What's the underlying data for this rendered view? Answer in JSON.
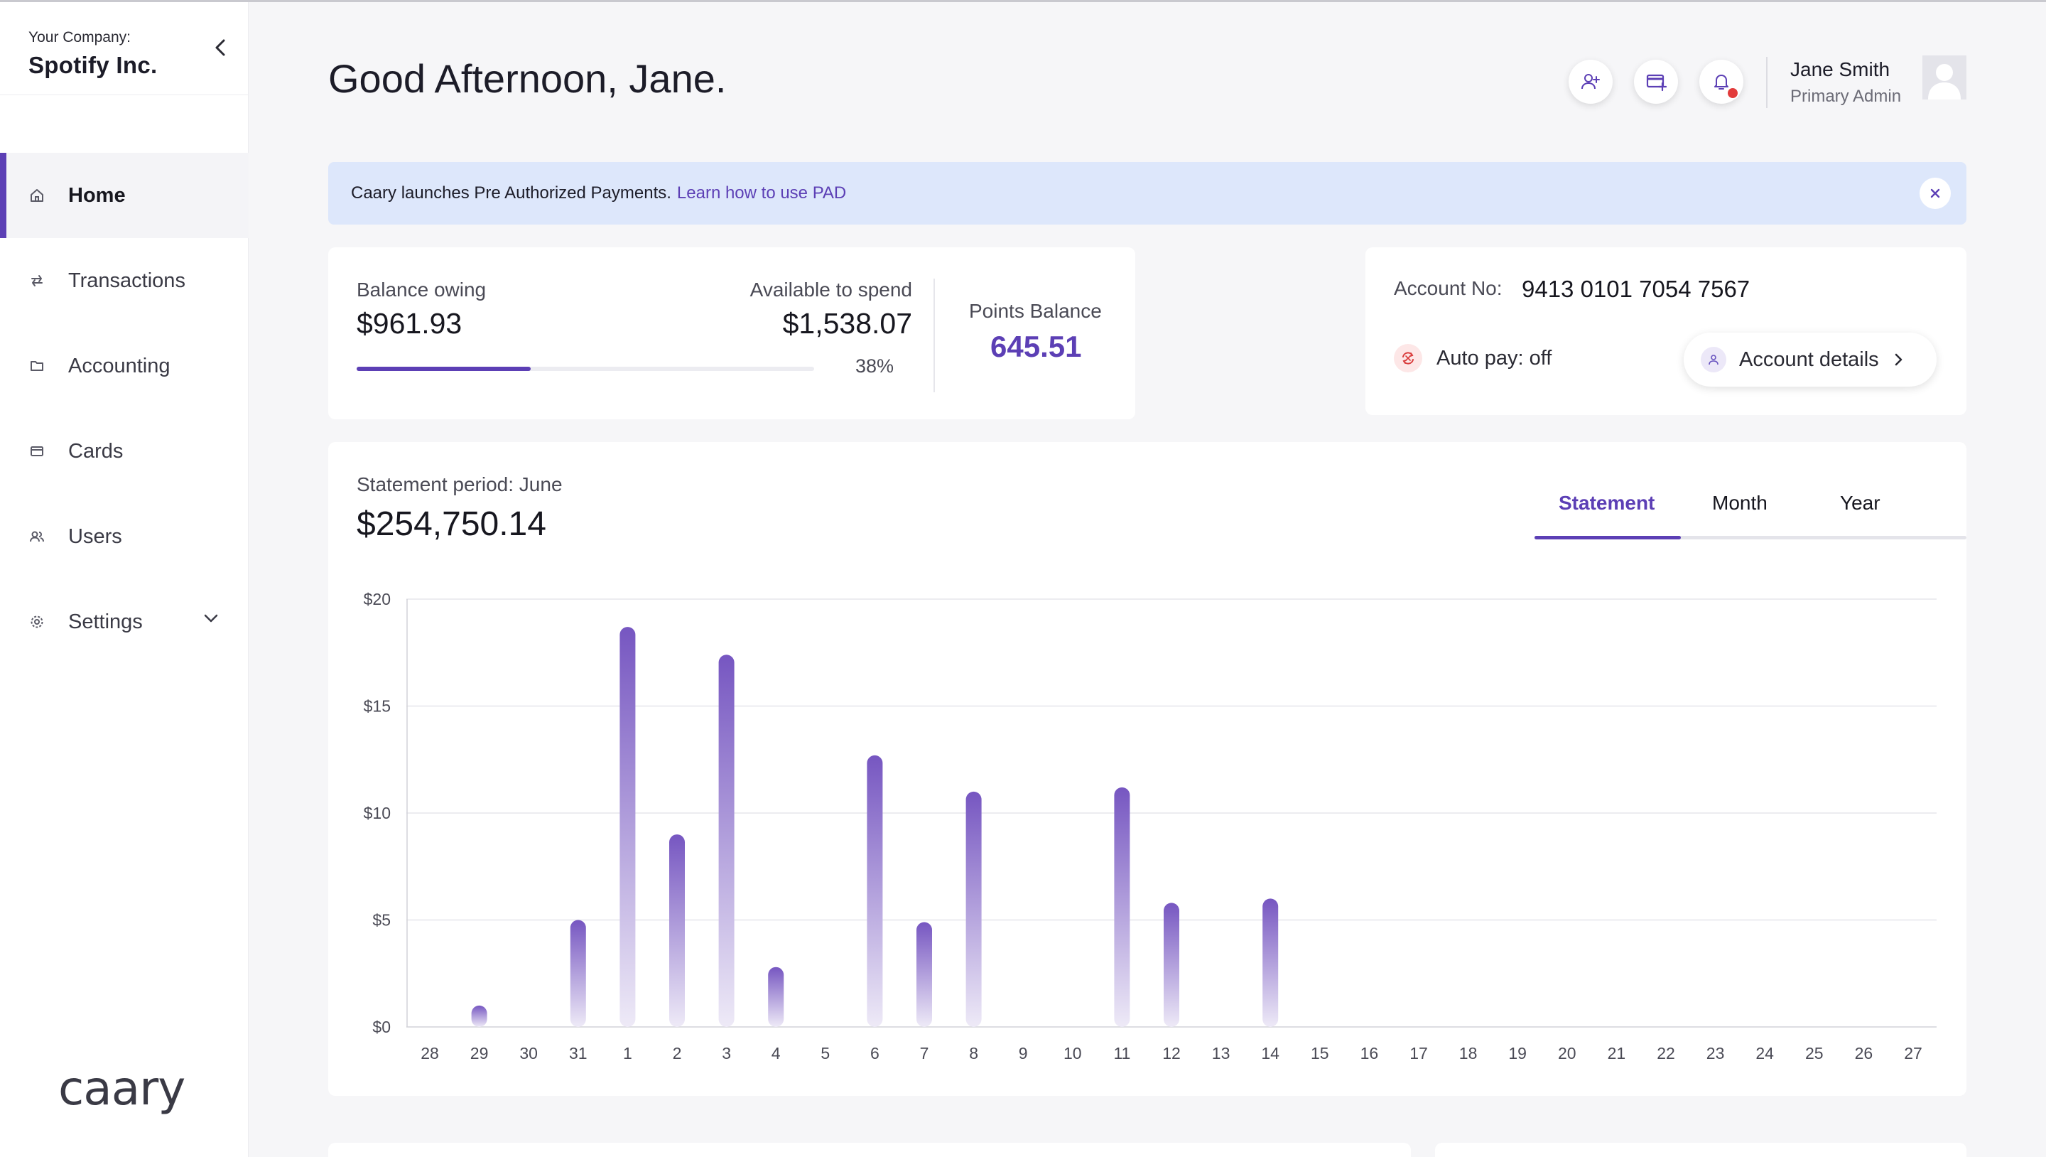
{
  "sidebar": {
    "company_label": "Your Company:",
    "company_name": "Spotify Inc.",
    "items": [
      {
        "label": "Home",
        "icon": "home-icon",
        "active": true
      },
      {
        "label": "Transactions",
        "icon": "transfer-icon"
      },
      {
        "label": "Accounting",
        "icon": "folder-icon"
      },
      {
        "label": "Cards",
        "icon": "card-icon"
      },
      {
        "label": "Users",
        "icon": "users-icon"
      },
      {
        "label": "Settings",
        "icon": "gear-icon",
        "expandable": true
      }
    ],
    "brand": "caary"
  },
  "header": {
    "greeting": "Good Afternoon, Jane.",
    "user_name": "Jane Smith",
    "user_role": "Primary Admin",
    "notification_dot_color": "#e23b3b"
  },
  "banner": {
    "text": "Caary launches Pre Authorized Payments.",
    "link": "Learn how to use PAD"
  },
  "balance": {
    "owing_label": "Balance owing",
    "owing_value": "$961.93",
    "available_label": "Available to spend",
    "available_value": "$1,538.07",
    "percent": "38%",
    "percent_value": 0.38,
    "points_label": "Points Balance",
    "points_value": "645.51"
  },
  "account": {
    "number_label": "Account No:",
    "number": "9413 0101 7054 7567",
    "autopay": "Auto pay: off",
    "details_button": "Account details"
  },
  "statement": {
    "period_label": "Statement period: June",
    "total": "$254,750.14",
    "tabs": [
      "Statement",
      "Month",
      "Year"
    ],
    "active_tab": "Statement"
  },
  "colors": {
    "accent": "#5c3fb5",
    "bar_top": "#7656c1",
    "bar_bottom": "#eeeaf7"
  },
  "chart_data": {
    "type": "bar",
    "title": "",
    "xlabel": "",
    "ylabel": "",
    "ylim": [
      0,
      20
    ],
    "y_ticks": [
      "$0",
      "$5",
      "$10",
      "$15",
      "$20"
    ],
    "y_tick_values": [
      0,
      5,
      10,
      15,
      20
    ],
    "grid": true,
    "categories": [
      "28",
      "29",
      "30",
      "31",
      "1",
      "2",
      "3",
      "4",
      "5",
      "6",
      "7",
      "8",
      "9",
      "10",
      "11",
      "12",
      "13",
      "14",
      "15",
      "16",
      "17",
      "18",
      "19",
      "20",
      "21",
      "22",
      "23",
      "24",
      "25",
      "26",
      "27"
    ],
    "values": [
      0,
      1,
      0,
      5,
      18.7,
      9,
      17.4,
      2.8,
      0,
      12.7,
      4.9,
      11,
      0,
      0,
      11.2,
      5.8,
      0,
      6,
      0,
      0,
      0,
      0,
      0,
      0,
      0,
      0,
      0,
      0,
      0,
      0,
      0
    ]
  }
}
